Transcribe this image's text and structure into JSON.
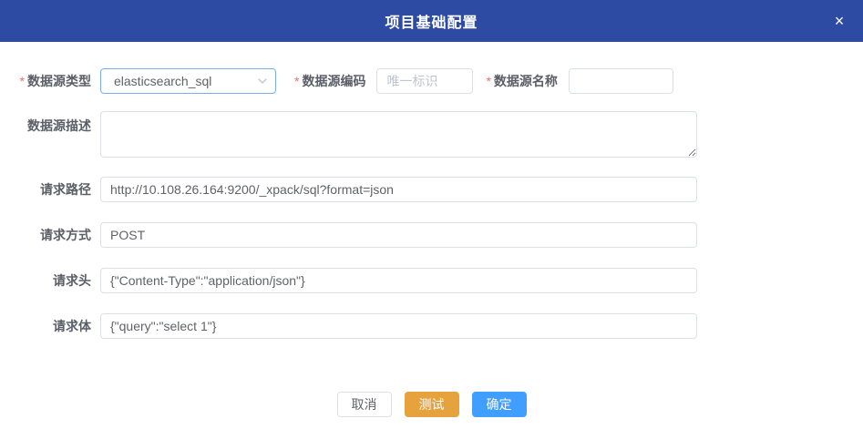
{
  "modal": {
    "title": "项目基础配置",
    "close_icon": "×"
  },
  "form": {
    "required_mark": "*",
    "fields": {
      "datasource_type": {
        "label": "数据源类型",
        "required": true,
        "value": "elasticsearch_sql"
      },
      "datasource_code": {
        "label": "数据源编码",
        "required": true,
        "value": "",
        "placeholder": "唯一标识"
      },
      "datasource_name": {
        "label": "数据源名称",
        "required": true,
        "value": ""
      },
      "datasource_desc": {
        "label": "数据源描述",
        "value": ""
      },
      "request_path": {
        "label": "请求路径",
        "value": "http://10.108.26.164:9200/_xpack/sql?format=json"
      },
      "request_method": {
        "label": "请求方式",
        "value": "POST"
      },
      "request_header": {
        "label": "请求头",
        "value": "{\"Content-Type\":\"application/json\"}"
      },
      "request_body": {
        "label": "请求体",
        "value": "{\"query\":\"select 1\"}"
      }
    }
  },
  "footer": {
    "cancel_label": "取消",
    "test_label": "测试",
    "confirm_label": "确定"
  },
  "colors": {
    "header_bg": "#2e4ba3",
    "primary_blue": "#409eff",
    "warning_orange": "#e6a23c",
    "required_red": "#f56c6c",
    "select_border": "#79aee6",
    "input_border": "#dcdfe6"
  }
}
